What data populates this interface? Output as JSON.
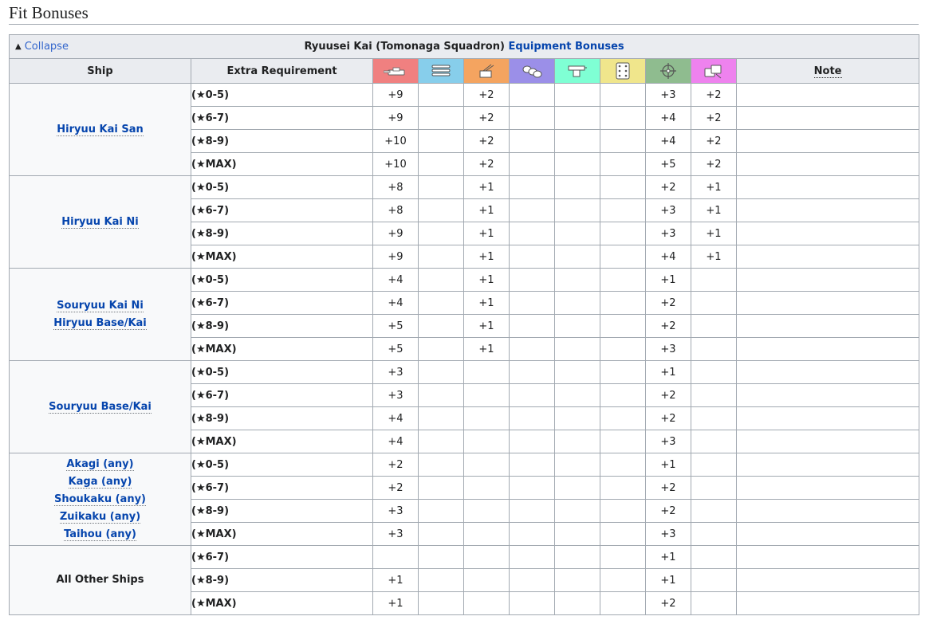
{
  "section_title": "Fit Bonuses",
  "collapse": {
    "symbol": "▲",
    "label": "Collapse"
  },
  "caption": {
    "equipment": "Ryuusei Kai (Tomonaga Squadron)",
    "link": "Equipment Bonuses"
  },
  "headers": {
    "ship": "Ship",
    "extra": "Extra Requirement",
    "note": "Note"
  },
  "stat_icons": [
    {
      "name": "firepower-icon",
      "color": "#f08080"
    },
    {
      "name": "torpedo-icon",
      "color": "#87ceeb"
    },
    {
      "name": "anti-air-icon",
      "color": "#f4a460"
    },
    {
      "name": "armor-icon",
      "color": "#9b8fe8"
    },
    {
      "name": "evasion-icon",
      "color": "#7fffd4"
    },
    {
      "name": "luck-icon",
      "color": "#f0e68c"
    },
    {
      "name": "accuracy-icon",
      "color": "#8fbc8f"
    },
    {
      "name": "anti-sub-icon",
      "color": "#ee82ee"
    }
  ],
  "groups": [
    {
      "ships": [
        {
          "name": "Hiryuu Kai San",
          "link": true
        }
      ],
      "rows": [
        {
          "req": "(★0-5)",
          "v": [
            "+9",
            "",
            "+2",
            "",
            "",
            "",
            "+3",
            "+2"
          ]
        },
        {
          "req": "(★6-7)",
          "v": [
            "+9",
            "",
            "+2",
            "",
            "",
            "",
            "+4",
            "+2"
          ]
        },
        {
          "req": "(★8-9)",
          "v": [
            "+10",
            "",
            "+2",
            "",
            "",
            "",
            "+4",
            "+2"
          ]
        },
        {
          "req": "(★MAX)",
          "v": [
            "+10",
            "",
            "+2",
            "",
            "",
            "",
            "+5",
            "+2"
          ]
        }
      ]
    },
    {
      "ships": [
        {
          "name": "Hiryuu Kai Ni",
          "link": true
        }
      ],
      "rows": [
        {
          "req": "(★0-5)",
          "v": [
            "+8",
            "",
            "+1",
            "",
            "",
            "",
            "+2",
            "+1"
          ]
        },
        {
          "req": "(★6-7)",
          "v": [
            "+8",
            "",
            "+1",
            "",
            "",
            "",
            "+3",
            "+1"
          ]
        },
        {
          "req": "(★8-9)",
          "v": [
            "+9",
            "",
            "+1",
            "",
            "",
            "",
            "+3",
            "+1"
          ]
        },
        {
          "req": "(★MAX)",
          "v": [
            "+9",
            "",
            "+1",
            "",
            "",
            "",
            "+4",
            "+1"
          ]
        }
      ]
    },
    {
      "ships": [
        {
          "name": "Souryuu Kai Ni",
          "link": true
        },
        {
          "name": "Hiryuu Base/Kai",
          "link": true
        }
      ],
      "rows": [
        {
          "req": "(★0-5)",
          "v": [
            "+4",
            "",
            "+1",
            "",
            "",
            "",
            "+1",
            ""
          ]
        },
        {
          "req": "(★6-7)",
          "v": [
            "+4",
            "",
            "+1",
            "",
            "",
            "",
            "+2",
            ""
          ]
        },
        {
          "req": "(★8-9)",
          "v": [
            "+5",
            "",
            "+1",
            "",
            "",
            "",
            "+2",
            ""
          ]
        },
        {
          "req": "(★MAX)",
          "v": [
            "+5",
            "",
            "+1",
            "",
            "",
            "",
            "+3",
            ""
          ]
        }
      ]
    },
    {
      "ships": [
        {
          "name": "Souryuu Base/Kai",
          "link": true
        }
      ],
      "rows": [
        {
          "req": "(★0-5)",
          "v": [
            "+3",
            "",
            "",
            "",
            "",
            "",
            "+1",
            ""
          ]
        },
        {
          "req": "(★6-7)",
          "v": [
            "+3",
            "",
            "",
            "",
            "",
            "",
            "+2",
            ""
          ]
        },
        {
          "req": "(★8-9)",
          "v": [
            "+4",
            "",
            "",
            "",
            "",
            "",
            "+2",
            ""
          ]
        },
        {
          "req": "(★MAX)",
          "v": [
            "+4",
            "",
            "",
            "",
            "",
            "",
            "+3",
            ""
          ]
        }
      ]
    },
    {
      "ships": [
        {
          "name": "Akagi (any)",
          "link": true
        },
        {
          "name": "Kaga (any)",
          "link": true
        },
        {
          "name": "Shoukaku (any)",
          "link": true
        },
        {
          "name": "Zuikaku (any)",
          "link": true
        },
        {
          "name": "Taihou (any)",
          "link": true
        }
      ],
      "rows": [
        {
          "req": "(★0-5)",
          "v": [
            "+2",
            "",
            "",
            "",
            "",
            "",
            "+1",
            ""
          ]
        },
        {
          "req": "(★6-7)",
          "v": [
            "+2",
            "",
            "",
            "",
            "",
            "",
            "+2",
            ""
          ]
        },
        {
          "req": "(★8-9)",
          "v": [
            "+3",
            "",
            "",
            "",
            "",
            "",
            "+2",
            ""
          ]
        },
        {
          "req": "(★MAX)",
          "v": [
            "+3",
            "",
            "",
            "",
            "",
            "",
            "+3",
            ""
          ]
        }
      ]
    },
    {
      "ships": [
        {
          "name": "All Other Ships",
          "link": false
        }
      ],
      "rows": [
        {
          "req": "(★6-7)",
          "v": [
            "",
            "",
            "",
            "",
            "",
            "",
            "+1",
            ""
          ]
        },
        {
          "req": "(★8-9)",
          "v": [
            "+1",
            "",
            "",
            "",
            "",
            "",
            "+1",
            ""
          ]
        },
        {
          "req": "(★MAX)",
          "v": [
            "+1",
            "",
            "",
            "",
            "",
            "",
            "+2",
            ""
          ]
        }
      ]
    }
  ]
}
